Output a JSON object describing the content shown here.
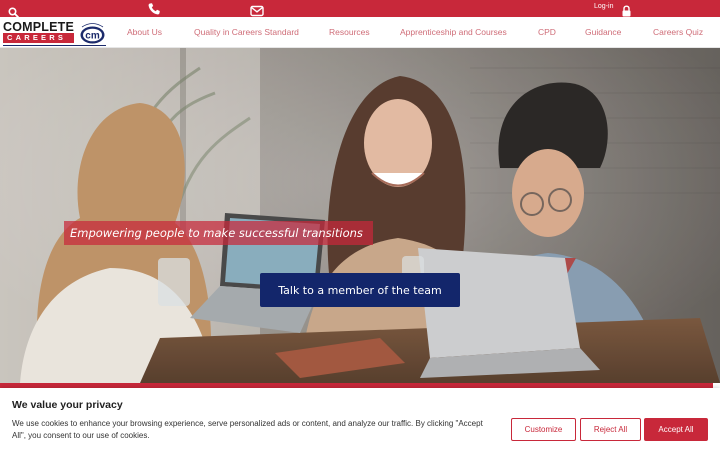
{
  "topbar": {
    "search_icon": "search-icon",
    "phone_icon": "phone-icon",
    "mail_icon": "mail-icon",
    "login_label": "Log-in",
    "lock_icon": "lock-icon",
    "color": "#c8283a"
  },
  "logo": {
    "word1": "COMPLETE",
    "word2": "CAREERS",
    "badge_text": "cm",
    "badge_arc": "CAREER MARK"
  },
  "nav": {
    "items": [
      "About Us",
      "Quality in Careers Standard",
      "Resources",
      "Apprenticeship and Courses",
      "CPD",
      "Guidance",
      "Careers Quiz"
    ]
  },
  "hero": {
    "tagline": "Empowering people to make successful transitions",
    "cta": "Talk to a member of the team"
  },
  "cookie": {
    "title": "We value your privacy",
    "text": "We use cookies to enhance your browsing experience, serve personalized ads or content, and analyze our traffic. By clicking \"Accept All\", you consent to our use of cookies.",
    "customize": "Customize",
    "reject": "Reject All",
    "accept": "Accept All"
  },
  "colors": {
    "brand_red": "#c8283a",
    "brand_navy": "#13266b",
    "nav_text": "#cf6d78"
  }
}
